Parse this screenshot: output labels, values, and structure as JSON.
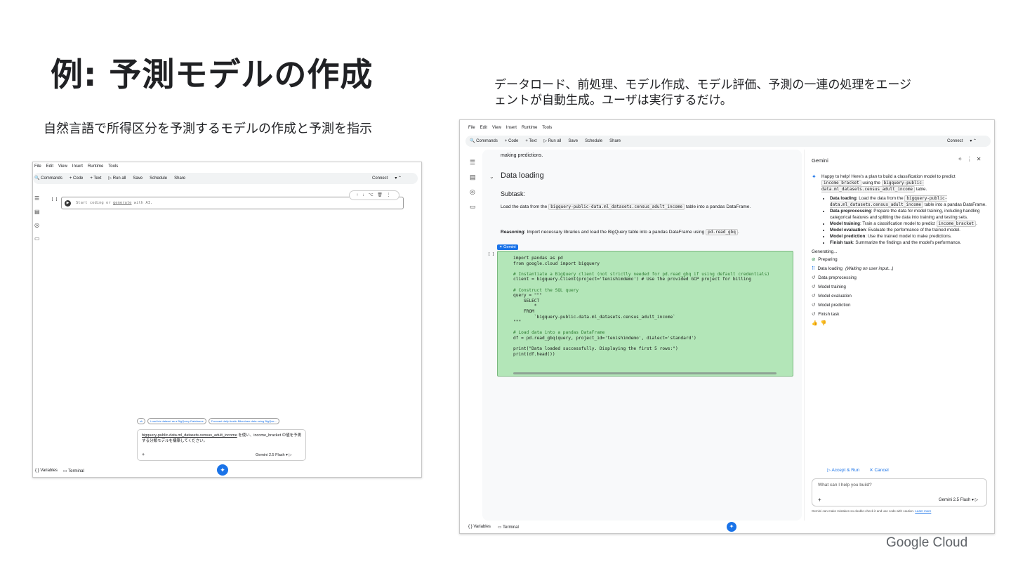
{
  "slide": {
    "title": "例: 予測モデルの作成",
    "left_caption": "自然言語で所得区分を予測するモデルの作成と予測を指示",
    "right_caption": "データロード、前処理、モデル作成、モデル評価、予測の一連の処理をエージェントが自動生成。ユーザは実行するだけ。",
    "footer_logo": "Google Cloud"
  },
  "menu": [
    "File",
    "Edit",
    "View",
    "Insert",
    "Runtime",
    "Tools"
  ],
  "toolbar": {
    "commands": "Commands",
    "code": "+ Code",
    "text": "+ Text",
    "run_all": "▷ Run all",
    "save": "Save",
    "schedule": "Schedule",
    "share": "Share",
    "connect": "Connect"
  },
  "left_shot": {
    "cell_bracket": "[ ]",
    "cell_placeholder_prefix": "Start coding or ",
    "cell_placeholder_link": "generate",
    "cell_placeholder_suffix": " with AI.",
    "suggestions": [
      "sh",
      "Load iris dataset as a BigQuery Dataframe",
      "Forecast daily Austin Bikeshare data using BigQue..."
    ],
    "prompt_text_link": "bigquery-public-data.ml_datasets.census_adult_income",
    "prompt_text_rest": " を使い、income_bracket の値を予測する分類モデルを構築してください。",
    "prompt_add": "+",
    "model": "Gemini 2.5 Flash",
    "variables": "Variables",
    "terminal": "Terminal"
  },
  "right_shot": {
    "making": "making predictions.",
    "section": "Data loading",
    "subtask": "Subtask:",
    "load_pre": "Load the data from the ",
    "load_code": "bigquery-public-data.ml_datasets.census_adult_income",
    "load_post": " table into a pandas DataFrame.",
    "reason_label": "Reasoning",
    "reason_text": ": Import necessary libraries and load the BigQuery table into a pandas DataFrame using ",
    "reason_code": "pd.read_gbq",
    "reason_end": ".",
    "gemini_tag": "✦ Gemini",
    "cell_bracket": "[ ]",
    "code_lines": [
      "import pandas as pd",
      "from google.cloud import bigquery",
      "",
      "# Instantiate a BigQuery client (not strictly needed for pd.read_gbq if using default credentials)",
      "client = bigquery.Client(project='tenishimdemo') # Use the provided GCP project for billing",
      "",
      "# Construct the SQL query",
      "query = \"\"\"",
      "    SELECT",
      "        *",
      "    FROM",
      "        `bigquery-public-data.ml_datasets.census_adult_income`",
      "\"\"\"",
      "",
      "# Load data into a pandas DataFrame",
      "df = pd.read_gbq(query, project_id='tenishimdemo', dialect='standard')",
      "",
      "print(\"Data loaded successfully. Displaying the first 5 rows:\")",
      "print(df.head())"
    ],
    "variables": "Variables",
    "terminal": "Terminal"
  },
  "gemini": {
    "title": "Gemini",
    "intro_pre": "Happy to help! Here's a plan to build a classification model to predict ",
    "intro_c1": "income_bracket",
    "intro_mid": " using the ",
    "intro_c2": "bigquery-public-data.ml_datasets.census_adult_income",
    "intro_post": " table.",
    "plan": [
      {
        "label": "Data loading",
        "text": ": Load the data from the ",
        "code": "bigquery-public-data.ml_datasets.census_adult_income",
        "text2": " table into a pandas DataFrame."
      },
      {
        "label": "Data preprocessing",
        "text": ": Prepare the data for model training, including handling categorical features and splitting the data into training and testing sets.",
        "code": "",
        "text2": ""
      },
      {
        "label": "Model training",
        "text": ": Train a classification model to predict ",
        "code": "income_bracket",
        "text2": "."
      },
      {
        "label": "Model evaluation",
        "text": ": Evaluate the performance of the trained model.",
        "code": "",
        "text2": ""
      },
      {
        "label": "Model prediction",
        "text": ": Use the trained model to make predictions.",
        "code": "",
        "text2": ""
      },
      {
        "label": "Finish task",
        "text": ": Summarize the findings and the model's performance.",
        "code": "",
        "text2": ""
      }
    ],
    "generating": "Generating...",
    "steps": [
      {
        "icon": "check-icon",
        "label": "Preparing",
        "note": ""
      },
      {
        "icon": "loading-icon",
        "label": "Data loading",
        "note": "(Waiting on user input...)"
      },
      {
        "icon": "history-icon",
        "label": "Data preprocessing",
        "note": ""
      },
      {
        "icon": "history-icon",
        "label": "Model training",
        "note": ""
      },
      {
        "icon": "history-icon",
        "label": "Model evaluation",
        "note": ""
      },
      {
        "icon": "history-icon",
        "label": "Model prediction",
        "note": ""
      },
      {
        "icon": "history-icon",
        "label": "Finish task",
        "note": ""
      }
    ],
    "accept": "▷ Accept & Run",
    "cancel": "✕ Cancel",
    "input_placeholder": "What can I help you build?",
    "add": "+",
    "model": "Gemini 2.5 Flash",
    "disclaimer": "Gemini can make mistakes so double-check it and use code with caution. ",
    "learn_more": "Learn more"
  }
}
